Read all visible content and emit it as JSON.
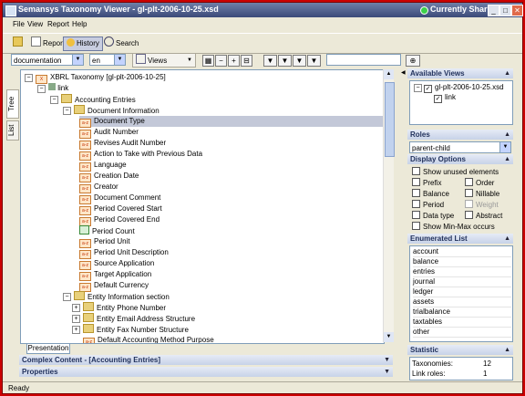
{
  "window": {
    "title": "Semansys Taxonomy Viewer - gl-plt-2006-10-25.xsd",
    "sharing": "Currently Sharing"
  },
  "menu": [
    "File",
    "View",
    "Report",
    "Help"
  ],
  "toolbar": {
    "report": "Report",
    "history": "History",
    "search": "Search"
  },
  "filters": {
    "label_type": "documentation",
    "language": "en",
    "views_label": "Views",
    "search_value": ""
  },
  "side_tabs": [
    "Tree",
    "List"
  ],
  "tree": {
    "root": "XBRL Taxonomy [gl-plt-2006-10-25]",
    "link": "link",
    "accounting": "Accounting Entries",
    "docinfo": "Document Information",
    "items": [
      "Document Type",
      "Audit Number",
      "Revises Audit Number",
      "Action to Take with Previous Data",
      "Language",
      "Creation Date",
      "Creator",
      "Document Comment",
      "Period Covered Start",
      "Period Covered End",
      "Period Count",
      "Period Unit",
      "Period Unit Description",
      "Source Application",
      "Target Application",
      "Default Currency"
    ],
    "entity": "Entity Information section",
    "entity_items": [
      "Entity Phone Number",
      "Entity Email Address Structure",
      "Entity Fax Number Structure",
      "Default Accounting Method Purpose"
    ]
  },
  "presentation_tab": "Presentation",
  "bottom_panels": {
    "complex": "Complex Content - [Accounting Entries]",
    "properties": "Properties"
  },
  "available_views": {
    "header": "Available Views",
    "file": "gl-plt-2006-10-25.xsd",
    "link": "link"
  },
  "roles": {
    "header": "Roles",
    "selected": "parent-child"
  },
  "display_options": {
    "header": "Display Options",
    "show_unused": "Show unused elements",
    "prefix": "Prefix",
    "order": "Order",
    "balance": "Balance",
    "nillable": "Nillable",
    "period": "Period",
    "weight": "Weight",
    "data_type": "Data type",
    "abstract": "Abstract",
    "show_minmax": "Show Min-Max occurs"
  },
  "enumerated": {
    "header": "Enumerated List",
    "items": [
      "account",
      "balance",
      "entries",
      "journal",
      "ledger",
      "assets",
      "trialbalance",
      "taxtables",
      "other"
    ]
  },
  "statistic": {
    "header": "Statistic",
    "taxonomies_label": "Taxonomies:",
    "taxonomies_value": "12",
    "linkroles_label": "Link roles:",
    "linkroles_value": "1"
  },
  "status": "Ready"
}
